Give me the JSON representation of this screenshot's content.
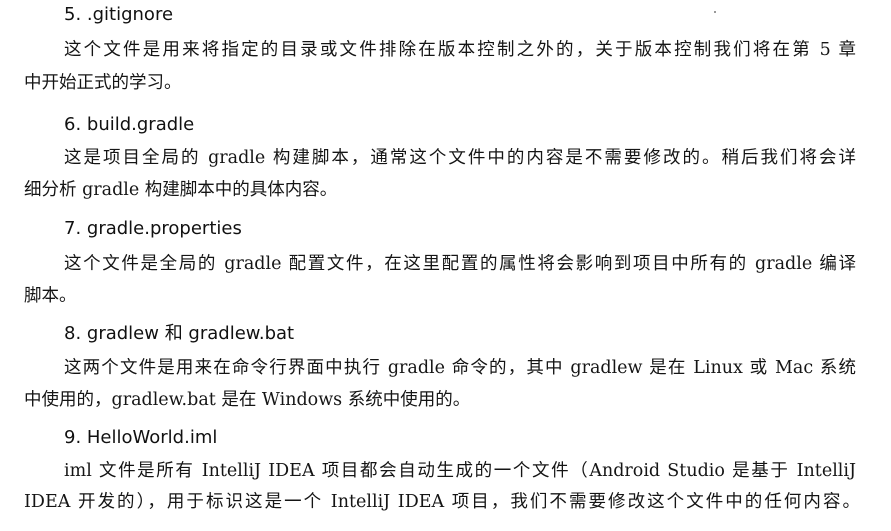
{
  "sections": [
    {
      "heading": "5. .gitignore",
      "lines": [
        "这个文件是用来将指定的目录或文件排除在版本控制之外的，关于版本控制我们将在第 5 章",
        "中开始正式的学习。"
      ]
    },
    {
      "heading": "6. build.gradle",
      "lines": [
        "这是项目全局的 gradle 构建脚本，通常这个文件中的内容是不需要修改的。稍后我们将会详",
        "细分析 gradle 构建脚本中的具体内容。"
      ]
    },
    {
      "heading": "7. gradle.properties",
      "lines": [
        "这个文件是全局的 gradle 配置文件，在这里配置的属性将会影响到项目中所有的 gradle 编译",
        "脚本。"
      ]
    },
    {
      "heading": "8. gradlew 和 gradlew.bat",
      "lines": [
        "这两个文件是用来在命令行界面中执行 gradle 命令的，其中 gradlew 是在 Linux 或 Mac 系统",
        "中使用的，gradlew.bat 是在 Windows 系统中使用的。"
      ]
    },
    {
      "heading": "9. HelloWorld.iml",
      "lines": [
        "iml 文件是所有 IntelliJ IDEA 项目都会自动生成的一个文件（Android Studio 是基于 IntelliJ",
        "IDEA 开发的），用于标识这是一个 IntelliJ IDEA 项目，我们不需要修改这个文件中的任何内容。"
      ]
    }
  ]
}
